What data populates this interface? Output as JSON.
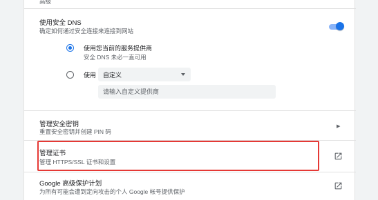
{
  "top_row": {
    "label": "高级"
  },
  "secure_dns": {
    "title": "使用安全 DNS",
    "description": "确定如何通过安全连接来连接到网站",
    "toggle_state": "on",
    "option_current": {
      "label": "使用您当前的服务提供商",
      "sublabel": "安全 DNS 未必一直可用",
      "selected": true
    },
    "option_custom": {
      "label": "使用",
      "selected": false,
      "dropdown_value": "自定义",
      "input_placeholder": "请输入自定义提供商"
    }
  },
  "security_keys": {
    "title": "管理安全密钥",
    "description": "重置安全密钥并创建 PIN 码"
  },
  "certificates": {
    "title": "管理证书",
    "description": "管理 HTTPS/SSL 证书和设置"
  },
  "advanced_protection": {
    "title": "Google 高级保护计划",
    "description": "为所有可能会遭到定向攻击的个人 Google 帐号提供保护"
  },
  "colors": {
    "accent": "#1a73e8",
    "highlight": "#e53935"
  }
}
